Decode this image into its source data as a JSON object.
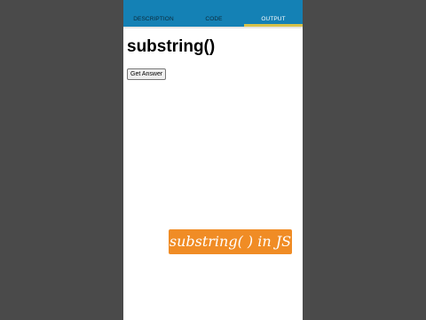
{
  "tabs": [
    {
      "label": "DESCRIPTION"
    },
    {
      "label": "CODE"
    },
    {
      "label": "OUTPUT"
    }
  ],
  "active_tab": "OUTPUT",
  "page": {
    "title": "substring()",
    "button_label": "Get Answer"
  },
  "caption": {
    "text": "substring( ) in JS"
  },
  "colors": {
    "tabbar": "#1481b5",
    "active_indicator": "#d6c14a",
    "caption_bg": "#f08c25",
    "backdrop": "#4a4a4a"
  }
}
